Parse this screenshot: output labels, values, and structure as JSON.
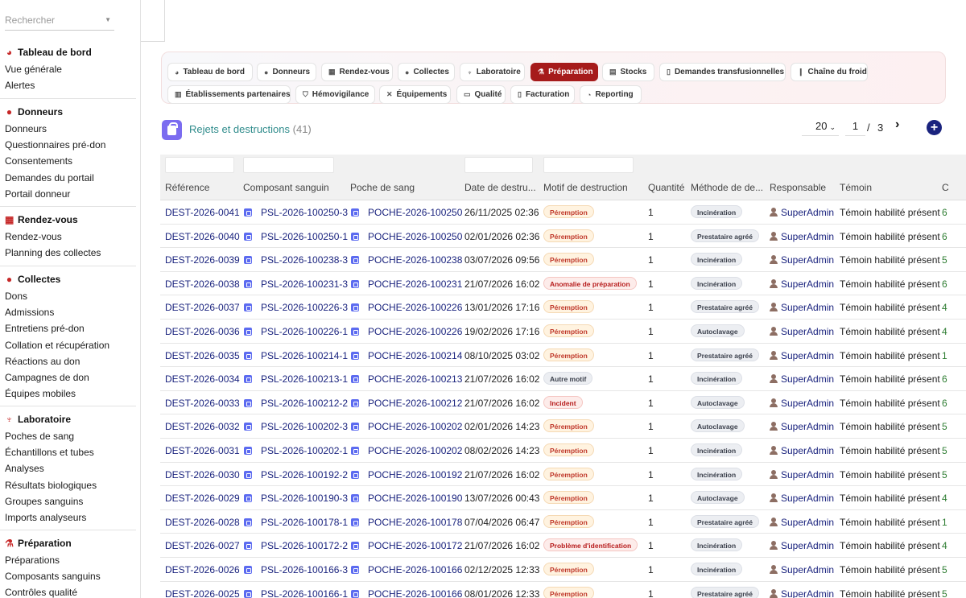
{
  "sidebar": {
    "search_placeholder": "Rechercher",
    "sections": [
      {
        "title": "Tableau de bord",
        "icon": "dashboard-icon",
        "items": [
          "Vue générale",
          "Alertes"
        ]
      },
      {
        "title": "Donneurs",
        "icon": "user-icon",
        "items": [
          "Donneurs",
          "Questionnaires pré-don",
          "Consentements",
          "Demandes du portail",
          "Portail donneur"
        ]
      },
      {
        "title": "Rendez-vous",
        "icon": "calendar-icon",
        "items": [
          "Rendez-vous",
          "Planning des collectes"
        ]
      },
      {
        "title": "Collectes",
        "icon": "drop-icon",
        "items": [
          "Dons",
          "Admissions",
          "Entretiens pré-don",
          "Collation et récupération",
          "Réactions au don",
          "Campagnes de don",
          "Équipes mobiles"
        ]
      },
      {
        "title": "Laboratoire",
        "icon": "microscope-icon",
        "items": [
          "Poches de sang",
          "Échantillons et tubes",
          "Analyses",
          "Résultats biologiques",
          "Groupes sanguins",
          "Imports analyseurs"
        ]
      },
      {
        "title": "Préparation",
        "icon": "flask-icon",
        "items": [
          "Préparations",
          "Composants sanguins",
          "Contrôles qualité"
        ]
      }
    ]
  },
  "nav": {
    "pills": [
      {
        "label": "Tableau de bord",
        "icon": "dashboard-icon"
      },
      {
        "label": "Donneurs",
        "icon": "user-icon"
      },
      {
        "label": "Rendez-vous",
        "icon": "calendar-icon"
      },
      {
        "label": "Collectes",
        "icon": "drop-icon"
      },
      {
        "label": "Laboratoire",
        "icon": "microscope-icon"
      },
      {
        "label": "Préparation",
        "icon": "flask-icon",
        "active": true
      },
      {
        "label": "Stocks",
        "icon": "warehouse-icon"
      },
      {
        "label": "Demandes transfusionnelles",
        "icon": "document-icon"
      },
      {
        "label": "Chaîne du froid",
        "icon": "thermometer-icon"
      },
      {
        "label": "Établissements partenaires",
        "icon": "building-icon"
      },
      {
        "label": "Hémovigilance",
        "icon": "shield-icon"
      },
      {
        "label": "Équipements",
        "icon": "tools-icon"
      },
      {
        "label": "Qualité",
        "icon": "clipboard-icon"
      },
      {
        "label": "Facturation",
        "icon": "invoice-icon"
      },
      {
        "label": "Reporting",
        "icon": "chart-pie-icon"
      }
    ]
  },
  "page": {
    "title": "Rejets et destructions",
    "count": "(41)",
    "page_size": "20",
    "current_page": "1",
    "page_sep": "/",
    "total_pages": "3",
    "next_icon": "chevron-right-icon",
    "add_icon": "plus-circle-icon"
  },
  "table": {
    "headers": [
      "Référence",
      "Composant sanguin",
      "Poche de sang",
      "Date de destru...",
      "Motif de destruction",
      "Quantité",
      "Méthode de de...",
      "Responsable",
      "Témoin",
      "C"
    ],
    "rows": [
      {
        "ref": "DEST-2026-0041",
        "comp": "PSL-2026-100250-3",
        "poche": "POCHE-2026-100250",
        "date": "26/11/2025 02:36",
        "motif": "Péremption",
        "motif_type": "warn",
        "qty": "1",
        "methode": "Incinération",
        "resp": "SuperAdmin",
        "temoin": "Témoin habilité présent",
        "extra": "6"
      },
      {
        "ref": "DEST-2026-0040",
        "comp": "PSL-2026-100250-1",
        "poche": "POCHE-2026-100250",
        "date": "02/01/2026 02:36",
        "motif": "Péremption",
        "motif_type": "warn",
        "qty": "1",
        "methode": "Prestataire agréé",
        "resp": "SuperAdmin",
        "temoin": "Témoin habilité présent",
        "extra": "6"
      },
      {
        "ref": "DEST-2026-0039",
        "comp": "PSL-2026-100238-3",
        "poche": "POCHE-2026-100238",
        "date": "03/07/2026 09:56",
        "motif": "Péremption",
        "motif_type": "warn",
        "qty": "1",
        "methode": "Incinération",
        "resp": "SuperAdmin",
        "temoin": "Témoin habilité présent",
        "extra": "5"
      },
      {
        "ref": "DEST-2026-0038",
        "comp": "PSL-2026-100231-3",
        "poche": "POCHE-2026-100231",
        "date": "21/07/2026 16:02",
        "motif": "Anomalie de préparation",
        "motif_type": "red",
        "qty": "1",
        "methode": "Incinération",
        "resp": "SuperAdmin",
        "temoin": "Témoin habilité présent",
        "extra": "6"
      },
      {
        "ref": "DEST-2026-0037",
        "comp": "PSL-2026-100226-3",
        "poche": "POCHE-2026-100226",
        "date": "13/01/2026 17:16",
        "motif": "Péremption",
        "motif_type": "warn",
        "qty": "1",
        "methode": "Prestataire agréé",
        "resp": "SuperAdmin",
        "temoin": "Témoin habilité présent",
        "extra": "4"
      },
      {
        "ref": "DEST-2026-0036",
        "comp": "PSL-2026-100226-1",
        "poche": "POCHE-2026-100226",
        "date": "19/02/2026 17:16",
        "motif": "Péremption",
        "motif_type": "warn",
        "qty": "1",
        "methode": "Autoclavage",
        "resp": "SuperAdmin",
        "temoin": "Témoin habilité présent",
        "extra": "4"
      },
      {
        "ref": "DEST-2026-0035",
        "comp": "PSL-2026-100214-1",
        "poche": "POCHE-2026-100214",
        "date": "08/10/2025 03:02",
        "motif": "Péremption",
        "motif_type": "warn",
        "qty": "1",
        "methode": "Prestataire agréé",
        "resp": "SuperAdmin",
        "temoin": "Témoin habilité présent",
        "extra": "1"
      },
      {
        "ref": "DEST-2026-0034",
        "comp": "PSL-2026-100213-1",
        "poche": "POCHE-2026-100213",
        "date": "21/07/2026 16:02",
        "motif": "Autre motif",
        "motif_type": "gray",
        "qty": "1",
        "methode": "Incinération",
        "resp": "SuperAdmin",
        "temoin": "Témoin habilité présent",
        "extra": "6"
      },
      {
        "ref": "DEST-2026-0033",
        "comp": "PSL-2026-100212-2",
        "poche": "POCHE-2026-100212",
        "date": "21/07/2026 16:02",
        "motif": "Incident",
        "motif_type": "red",
        "qty": "1",
        "methode": "Autoclavage",
        "resp": "SuperAdmin",
        "temoin": "Témoin habilité présent",
        "extra": "6"
      },
      {
        "ref": "DEST-2026-0032",
        "comp": "PSL-2026-100202-3",
        "poche": "POCHE-2026-100202",
        "date": "02/01/2026 14:23",
        "motif": "Péremption",
        "motif_type": "warn",
        "qty": "1",
        "methode": "Autoclavage",
        "resp": "SuperAdmin",
        "temoin": "Témoin habilité présent",
        "extra": "5"
      },
      {
        "ref": "DEST-2026-0031",
        "comp": "PSL-2026-100202-1",
        "poche": "POCHE-2026-100202",
        "date": "08/02/2026 14:23",
        "motif": "Péremption",
        "motif_type": "warn",
        "qty": "1",
        "methode": "Incinération",
        "resp": "SuperAdmin",
        "temoin": "Témoin habilité présent",
        "extra": "5"
      },
      {
        "ref": "DEST-2026-0030",
        "comp": "PSL-2026-100192-2",
        "poche": "POCHE-2026-100192",
        "date": "21/07/2026 16:02",
        "motif": "Péremption",
        "motif_type": "warn",
        "qty": "1",
        "methode": "Incinération",
        "resp": "SuperAdmin",
        "temoin": "Témoin habilité présent",
        "extra": "5"
      },
      {
        "ref": "DEST-2026-0029",
        "comp": "PSL-2026-100190-3",
        "poche": "POCHE-2026-100190",
        "date": "13/07/2026 00:43",
        "motif": "Péremption",
        "motif_type": "warn",
        "qty": "1",
        "methode": "Autoclavage",
        "resp": "SuperAdmin",
        "temoin": "Témoin habilité présent",
        "extra": "4"
      },
      {
        "ref": "DEST-2026-0028",
        "comp": "PSL-2026-100178-1",
        "poche": "POCHE-2026-100178",
        "date": "07/04/2026 06:47",
        "motif": "Péremption",
        "motif_type": "warn",
        "qty": "1",
        "methode": "Prestataire agréé",
        "resp": "SuperAdmin",
        "temoin": "Témoin habilité présent",
        "extra": "1"
      },
      {
        "ref": "DEST-2026-0027",
        "comp": "PSL-2026-100172-2",
        "poche": "POCHE-2026-100172",
        "date": "21/07/2026 16:02",
        "motif": "Problème d'identification",
        "motif_type": "red",
        "qty": "1",
        "methode": "Incinération",
        "resp": "SuperAdmin",
        "temoin": "Témoin habilité présent",
        "extra": "4"
      },
      {
        "ref": "DEST-2026-0026",
        "comp": "PSL-2026-100166-3",
        "poche": "POCHE-2026-100166",
        "date": "02/12/2025 12:33",
        "motif": "Péremption",
        "motif_type": "warn",
        "qty": "1",
        "methode": "Incinération",
        "resp": "SuperAdmin",
        "temoin": "Témoin habilité présent",
        "extra": "5"
      },
      {
        "ref": "DEST-2026-0025",
        "comp": "PSL-2026-100166-1",
        "poche": "POCHE-2026-100166",
        "date": "08/01/2026 12:33",
        "motif": "Péremption",
        "motif_type": "warn",
        "qty": "1",
        "methode": "Prestataire agréé",
        "resp": "SuperAdmin",
        "temoin": "Témoin habilité présent",
        "extra": "5"
      }
    ]
  }
}
